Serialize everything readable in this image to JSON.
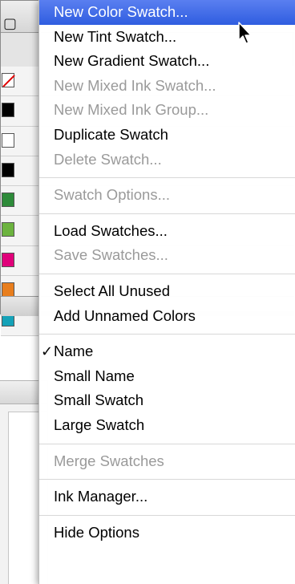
{
  "panel": {
    "swatch_colors": [
      "none",
      "#000000",
      "#ffffff",
      "#000000",
      "#2e8b3a",
      "#6cb33f",
      "#e0007a",
      "#e87e1e",
      "#15a2b8"
    ]
  },
  "menu": {
    "groups": [
      [
        {
          "label": "New Color Swatch...",
          "enabled": true,
          "highlighted": true
        },
        {
          "label": "New Tint Swatch...",
          "enabled": true
        },
        {
          "label": "New Gradient Swatch...",
          "enabled": true
        },
        {
          "label": "New Mixed Ink Swatch...",
          "enabled": false
        },
        {
          "label": "New Mixed Ink Group...",
          "enabled": false
        },
        {
          "label": "Duplicate Swatch",
          "enabled": true
        },
        {
          "label": "Delete Swatch...",
          "enabled": false
        }
      ],
      [
        {
          "label": "Swatch Options...",
          "enabled": false
        }
      ],
      [
        {
          "label": "Load Swatches...",
          "enabled": true
        },
        {
          "label": "Save Swatches...",
          "enabled": false
        }
      ],
      [
        {
          "label": "Select All Unused",
          "enabled": true
        },
        {
          "label": "Add Unnamed Colors",
          "enabled": true
        }
      ],
      [
        {
          "label": "Name",
          "enabled": true,
          "checked": true
        },
        {
          "label": "Small Name",
          "enabled": true
        },
        {
          "label": "Small Swatch",
          "enabled": true
        },
        {
          "label": "Large Swatch",
          "enabled": true
        }
      ],
      [
        {
          "label": "Merge Swatches",
          "enabled": false
        }
      ],
      [
        {
          "label": "Ink Manager...",
          "enabled": true
        }
      ],
      [
        {
          "label": "Hide Options",
          "enabled": true
        }
      ]
    ],
    "check_glyph": "✓"
  }
}
